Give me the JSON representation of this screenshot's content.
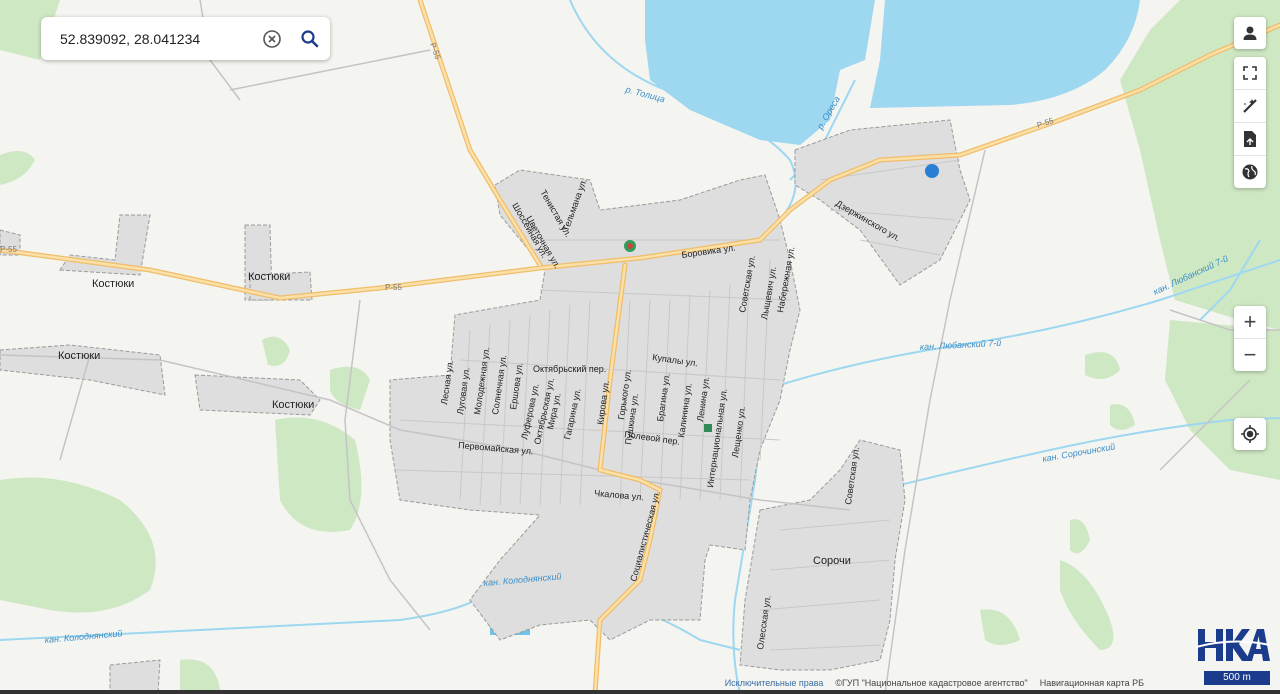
{
  "search": {
    "value": "52.839092, 28.041234",
    "clear_icon": "close-circle-icon",
    "search_icon": "search-icon"
  },
  "controls": {
    "account_icon": "person-icon",
    "fullscreen_icon": "fullscreen-icon",
    "measure_icon": "ruler-icon",
    "report_icon": "document-icon",
    "layers_icon": "globe-icon",
    "zoom_in": "+",
    "zoom_out": "−",
    "locate_icon": "crosshair-icon"
  },
  "map_labels": {
    "places": [
      "Костюки",
      "Костюки",
      "Костюки",
      "Костюки",
      "Сорочи"
    ],
    "streets": [
      "Боровика ул.",
      "Купалы ул.",
      "Октябрьский пер.",
      "Полевой пер.",
      "Первомайская ул.",
      "Чкалова ул.",
      "Социалистическая ул.",
      "Советская ул.",
      "Набережная ул.",
      "Лыщевич ул.",
      "Луговая ул.",
      "Молодежная ул.",
      "Солнечная ул.",
      "Ершова ул.",
      "Лесная ул.",
      "Луферова ул.",
      "Октябрьская ул.",
      "Мира ул.",
      "Гагарина ул.",
      "Кирова ул.",
      "Горького ул.",
      "Пушкина ул.",
      "Брагина ул.",
      "Калинина ул.",
      "Ленина ул.",
      "Интернациональная ул.",
      "Лещенко ул.",
      "Дзержинского ул.",
      "Советская ул.",
      "Олесская ул.",
      "Тельмана ул.",
      "Цветочная ул.",
      "Шоссейная ул.",
      "Тенистая ул."
    ],
    "waterways": [
      "р. Толица",
      "р. Ореса",
      "кан. Любанский 7-й",
      "кан. Любанский 7-й",
      "кан. Сорочинский",
      "кан. Колоднянский",
      "кан. Колоднянский"
    ],
    "roads": [
      "Р-55",
      "Р-55",
      "Р-55",
      "Р-55"
    ]
  },
  "attribution": {
    "rights": "Исключительные права",
    "agency": "©ГУП \"Национальное кадастровое агентство\"",
    "map_name": "Навигационная карта РБ"
  },
  "scale_label": "500 m",
  "logo_text": "НКА",
  "colors": {
    "water": "#9dd7f0",
    "forest": "#cfe8c4",
    "urban": "#dcdcdc",
    "road_main": "#f3c97e",
    "accent": "#1b3c8c"
  }
}
